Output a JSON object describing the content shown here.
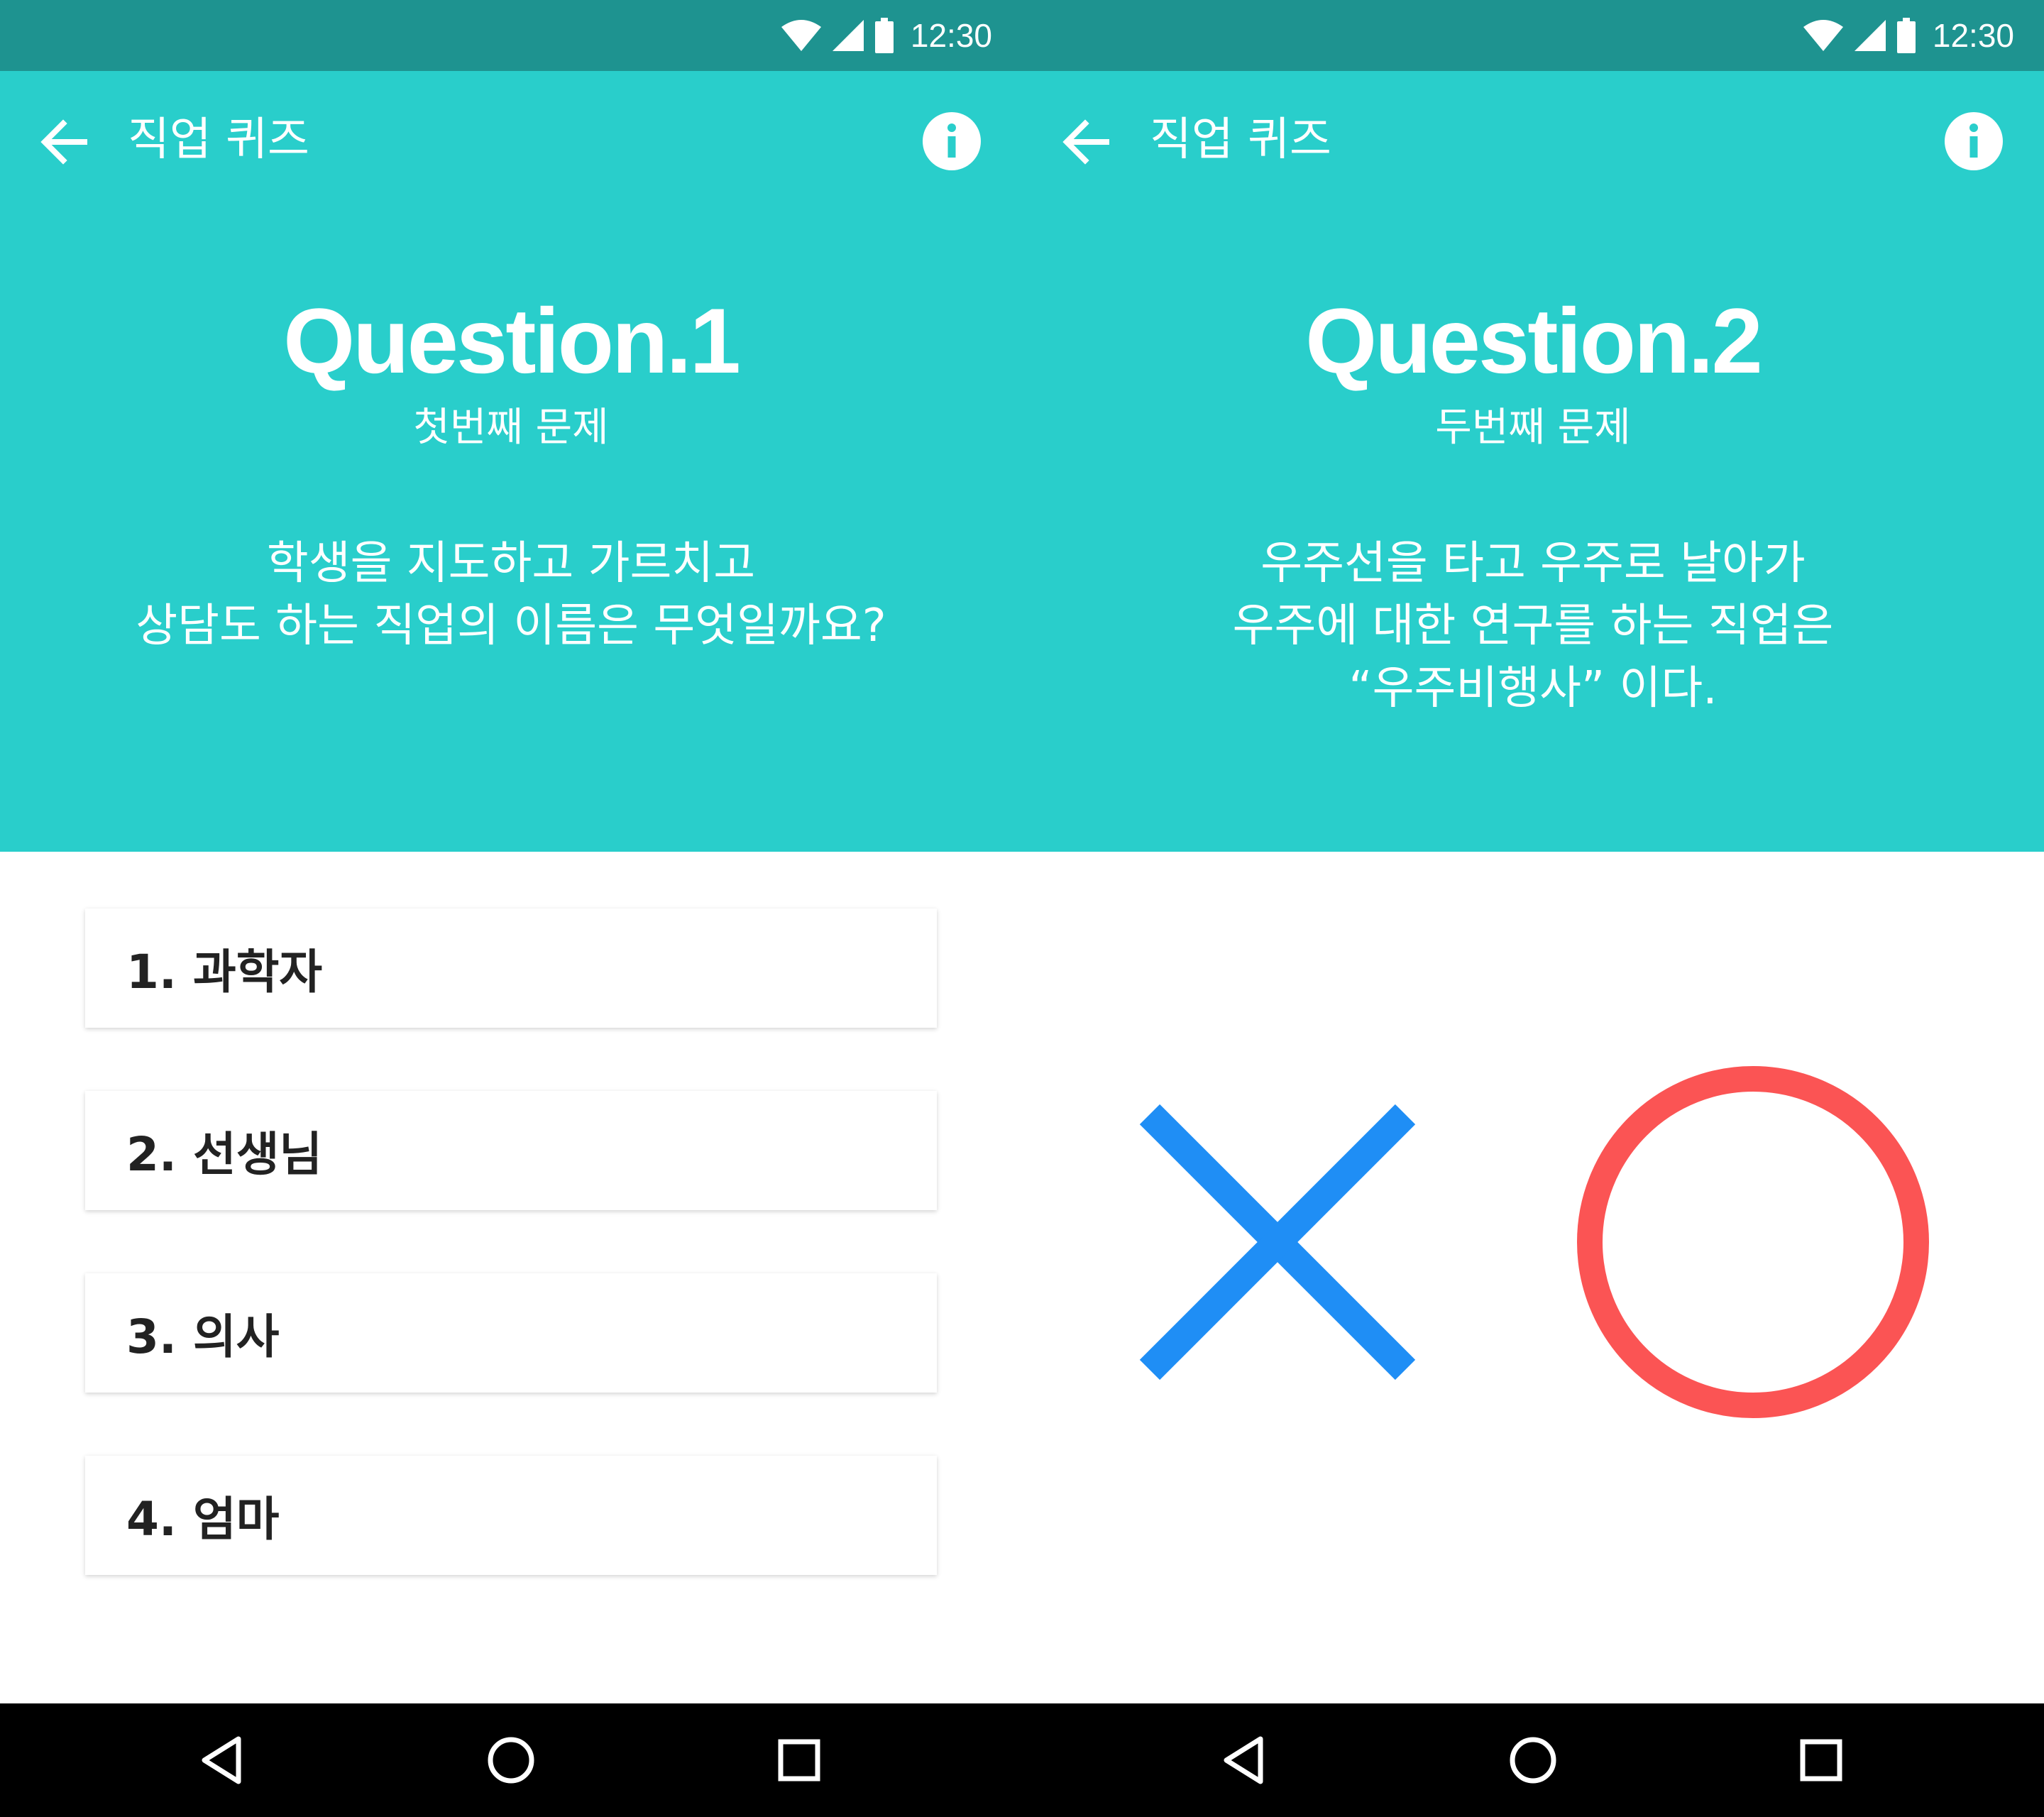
{
  "status_bar": {
    "time": "12:30"
  },
  "colors": {
    "status_bar": "#1e9390",
    "header": "#29cecb",
    "x_mark": "#1f8ef5",
    "o_mark": "#fb5454",
    "nav_bar": "#000000"
  },
  "screens": [
    {
      "app_title": "직업 퀴즈",
      "question_title": "Question.1",
      "question_subtitle": "첫번째 문제",
      "question_lines": [
        "학생을 지도하고 가르치고",
        "상담도 하는 직업의 이름은 무엇일까요?"
      ],
      "options": [
        "1. 과학자",
        "2. 선생님",
        "3. 의사",
        "4. 엄마"
      ]
    },
    {
      "app_title": "직업 퀴즈",
      "question_title": "Question.2",
      "question_subtitle": "두번째 문제",
      "question_lines": [
        "우주선을 타고 우주로 날아가",
        "우주에 대한 연구를 하는 직업은",
        "“우주비행사” 이다."
      ],
      "ox": {
        "x_icon": "x-icon",
        "o_icon": "o-icon"
      }
    }
  ]
}
